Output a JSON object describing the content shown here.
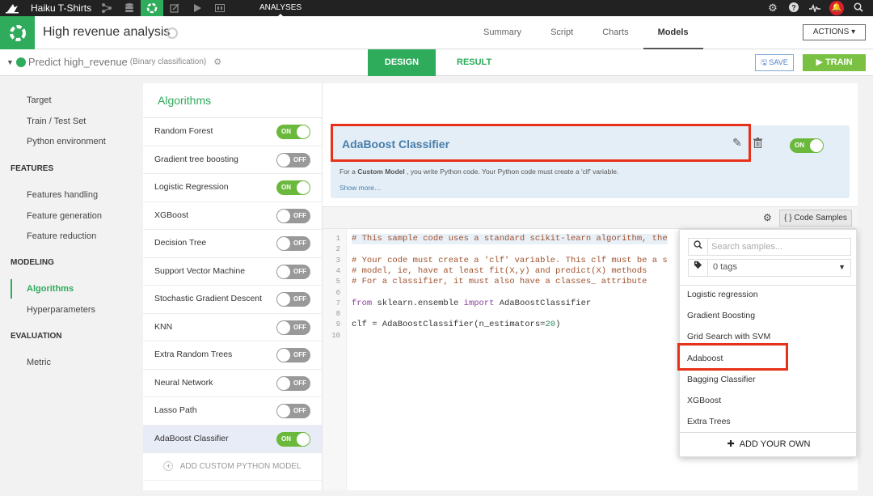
{
  "topbar": {
    "project_name": "Haiku T-Shirts",
    "nav_icons": [
      "flow-icon",
      "datasets-icon",
      "analyses-icon",
      "notebooks-icon",
      "jobs-icon",
      "dashboards-icon"
    ],
    "active_section": "ANALYSES",
    "right_icons": [
      "gear-icon",
      "help-icon",
      "activity-icon",
      "notification-bell-icon",
      "search-icon"
    ]
  },
  "header": {
    "title": "High revenue analysis",
    "tabs": [
      {
        "label": "Summary",
        "active": false
      },
      {
        "label": "Script",
        "active": false
      },
      {
        "label": "Charts",
        "active": false
      },
      {
        "label": "Models",
        "active": true
      }
    ],
    "actions_label": "ACTIONS ▾"
  },
  "subheader": {
    "prediction": "Predict high_revenue",
    "prediction_type": "(Binary classification)",
    "design_tab": "DESIGN",
    "result_tab": "RESULT",
    "save_label": "SAVE",
    "train_label": "▶ TRAIN"
  },
  "sidebar": {
    "items": [
      {
        "label": "Target",
        "type": "item"
      },
      {
        "label": "Train / Test Set",
        "type": "item"
      },
      {
        "label": "Python environment",
        "type": "item"
      },
      {
        "label": "FEATURES",
        "type": "section"
      },
      {
        "label": "Features handling",
        "type": "item"
      },
      {
        "label": "Feature generation",
        "type": "item"
      },
      {
        "label": "Feature reduction",
        "type": "item"
      },
      {
        "label": "MODELING",
        "type": "section"
      },
      {
        "label": "Algorithms",
        "type": "item",
        "active": true
      },
      {
        "label": "Hyperparameters",
        "type": "item"
      },
      {
        "label": "EVALUATION",
        "type": "section"
      },
      {
        "label": "Metric",
        "type": "item"
      }
    ]
  },
  "algorithms": {
    "title": "Algorithms",
    "on_label": "ON",
    "off_label": "OFF",
    "list": [
      {
        "name": "Random Forest",
        "enabled": true
      },
      {
        "name": "Gradient tree boosting",
        "enabled": false
      },
      {
        "name": "Logistic Regression",
        "enabled": true
      },
      {
        "name": "XGBoost",
        "enabled": false
      },
      {
        "name": "Decision Tree",
        "enabled": false
      },
      {
        "name": "Support Vector Machine",
        "enabled": false
      },
      {
        "name": "Stochastic Gradient Descent",
        "enabled": false
      },
      {
        "name": "KNN",
        "enabled": false
      },
      {
        "name": "Extra Random Trees",
        "enabled": false
      },
      {
        "name": "Neural Network",
        "enabled": false
      },
      {
        "name": "Lasso Path",
        "enabled": false
      },
      {
        "name": "AdaBoost Classifier",
        "enabled": true,
        "selected": true
      }
    ],
    "add_custom_label": "ADD CUSTOM PYTHON MODEL"
  },
  "model": {
    "name": "AdaBoost Classifier",
    "enabled": true,
    "desc_prefix": "For a ",
    "desc_bold": "Custom Model",
    "desc_suffix": " , you write Python code. Your Python code must create a 'clf' variable.",
    "show_more": "Show more…",
    "code_samples_label": "{ } Code Samples"
  },
  "code": {
    "lines": [
      {
        "n": "1",
        "parts": [
          {
            "t": "# This sample code uses a standard scikit-learn algorithm, the",
            "c": "cm"
          }
        ],
        "hl": true
      },
      {
        "n": "2",
        "parts": []
      },
      {
        "n": "3",
        "parts": [
          {
            "t": "# Your code must create a 'clf' variable. This clf must be a s",
            "c": "cm"
          }
        ]
      },
      {
        "n": "4",
        "parts": [
          {
            "t": "# model, ie, have at least fit(X,y) and predict(X) methods",
            "c": "cm"
          }
        ]
      },
      {
        "n": "5",
        "parts": [
          {
            "t": "# For a classifier, it must also have a classes_ attribute",
            "c": "cm"
          }
        ]
      },
      {
        "n": "6",
        "parts": []
      },
      {
        "n": "7",
        "parts": [
          {
            "t": "from",
            "c": "kw"
          },
          {
            "t": " sklearn.ensemble ",
            "c": ""
          },
          {
            "t": "import",
            "c": "kw"
          },
          {
            "t": " AdaBoostClassifier",
            "c": ""
          }
        ]
      },
      {
        "n": "8",
        "parts": []
      },
      {
        "n": "9",
        "parts": [
          {
            "t": "clf = AdaBoostClassifier(n_estimators=",
            "c": ""
          },
          {
            "t": "20",
            "c": "num"
          },
          {
            "t": ")",
            "c": ""
          }
        ]
      },
      {
        "n": "10",
        "parts": []
      }
    ]
  },
  "samples_dropdown": {
    "search_placeholder": "Search samples...",
    "tags_value": "0 tags",
    "options": [
      "Logistic regression",
      "Gradient Boosting",
      "Grid Search with SVM",
      "Adaboost",
      "Bagging Classifier",
      "XGBoost",
      "Extra Trees"
    ],
    "highlighted": "Adaboost",
    "add_own_label": "ADD YOUR OWN"
  },
  "colors": {
    "brand_green": "#2eab5b",
    "toggle_on": "#6bb93c",
    "highlight_red": "#e8311a",
    "train_green": "#7ac143"
  }
}
